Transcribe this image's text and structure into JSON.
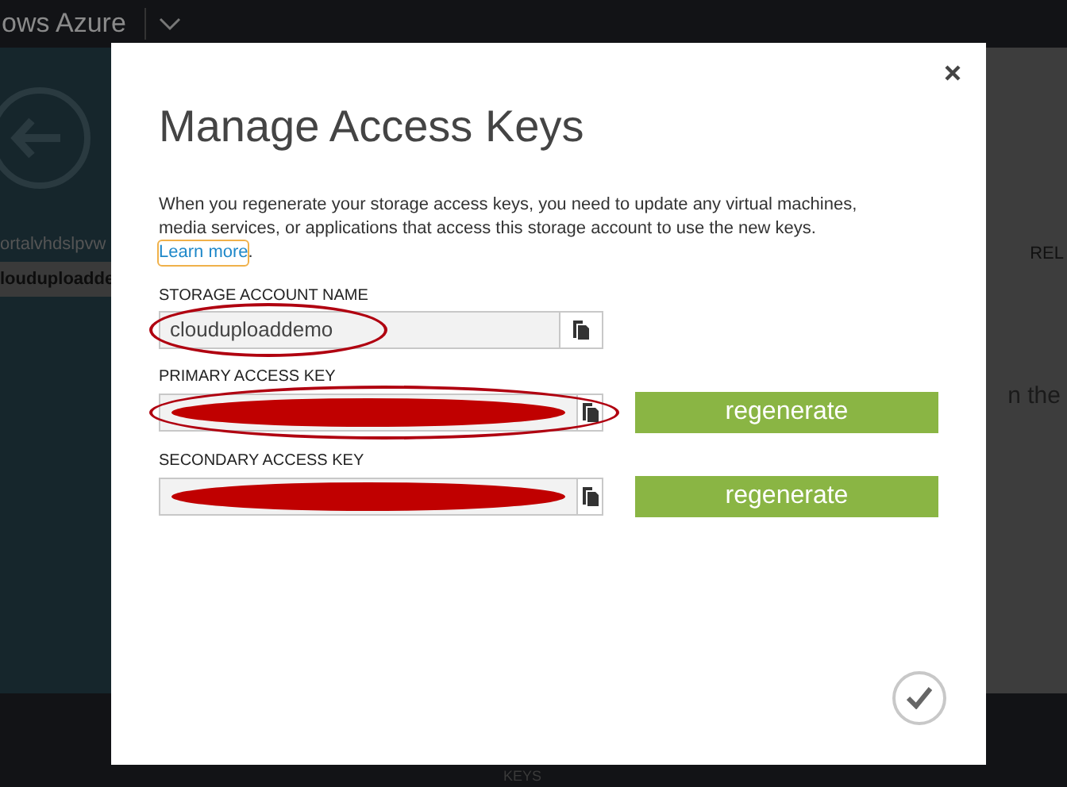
{
  "background": {
    "brand": "ows Azure",
    "list_items": [
      "ortalvhdslpvw",
      "louduploadde"
    ],
    "column_header": "REL",
    "body_text": "n the",
    "command_label": "KEYS"
  },
  "dialog": {
    "title": "Manage Access Keys",
    "description": "When you regenerate your storage access keys, you need to update any virtual machines, media services, or applications that access this storage account to use the new keys.",
    "link": "Learn more",
    "link_suffix": ".",
    "fields": [
      {
        "label": "STORAGE ACCOUNT NAME",
        "value": "clouduploaddemo",
        "redacted": false,
        "circled": true
      },
      {
        "label": "PRIMARY ACCESS KEY",
        "redacted": true,
        "circled": true,
        "regenerate": "regenerate"
      },
      {
        "label": "SECONDARY ACCESS KEY",
        "redacted": true,
        "circled": false,
        "regenerate": "regenerate"
      }
    ]
  }
}
